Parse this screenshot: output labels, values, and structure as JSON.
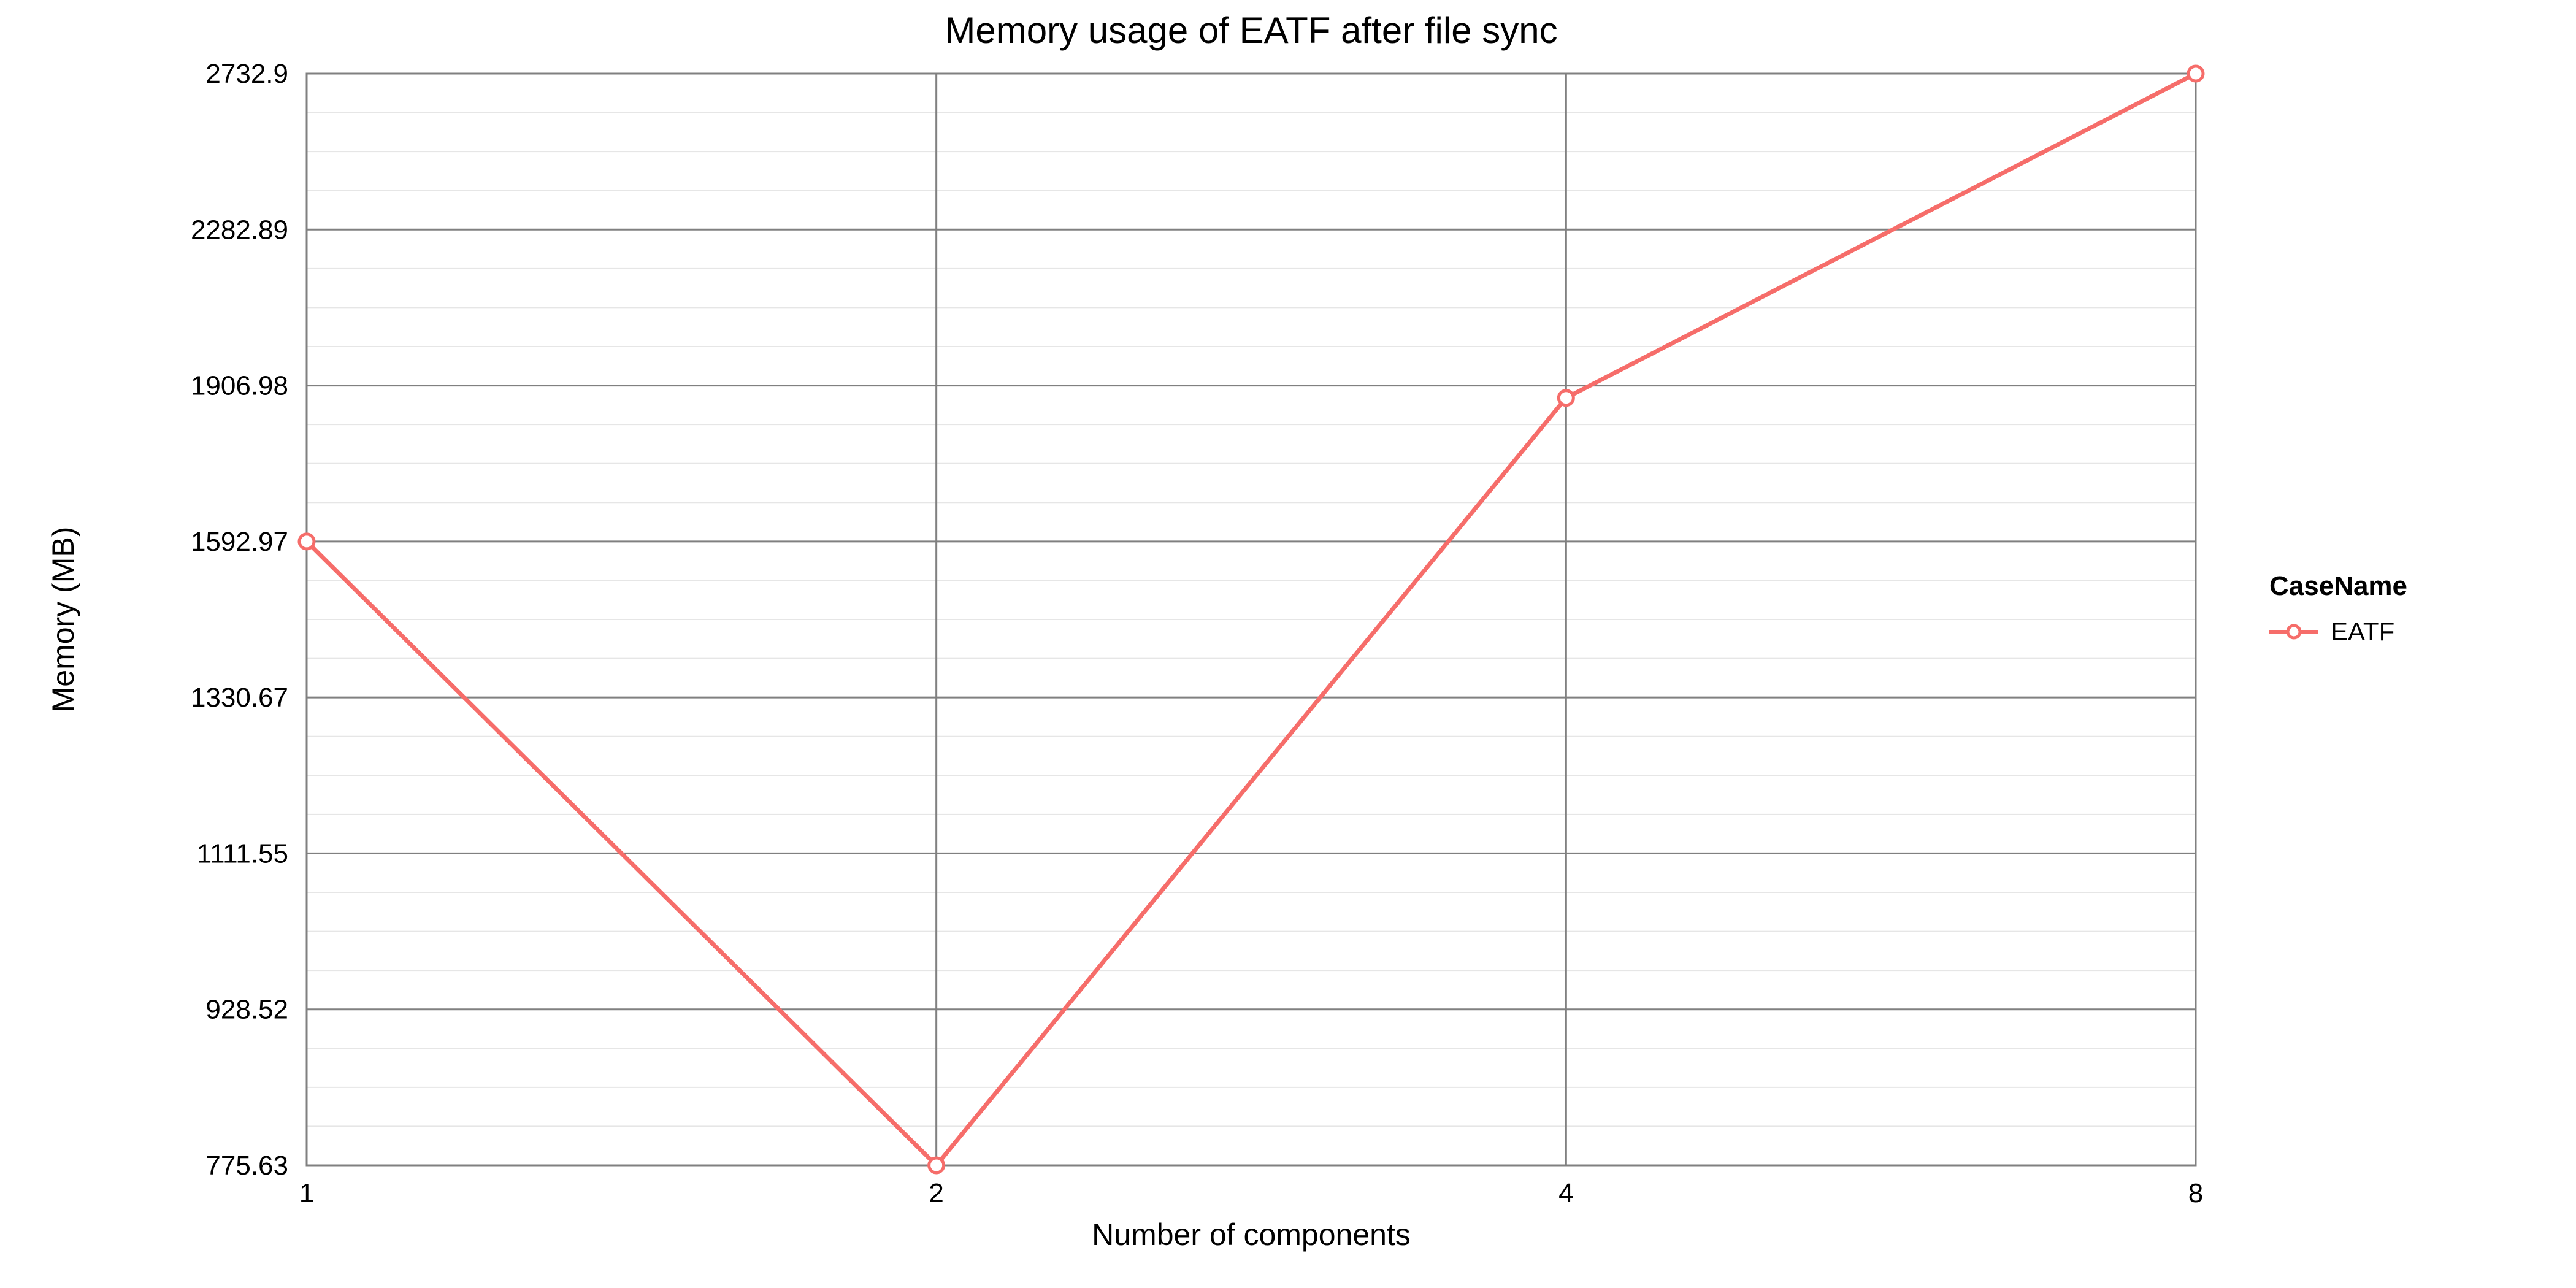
{
  "chart_data": {
    "type": "line",
    "title": "Memory usage of EATF after file sync",
    "xlabel": "Number of components",
    "ylabel": "Memory (MB)",
    "x_ticks": [
      1,
      2,
      4,
      8
    ],
    "y_ticks": [
      775.63,
      928.52,
      1111.55,
      1330.67,
      1592.97,
      1906.98,
      2282.89,
      2732.9
    ],
    "series": [
      {
        "name": "EATF",
        "x": [
          1,
          2,
          4,
          8
        ],
        "y": [
          1592.97,
          775.63,
          1880,
          2732.9
        ],
        "color": "#f66d6a"
      }
    ],
    "legend_title": "CaseName",
    "x_scale": "log",
    "y_scale": "log"
  }
}
